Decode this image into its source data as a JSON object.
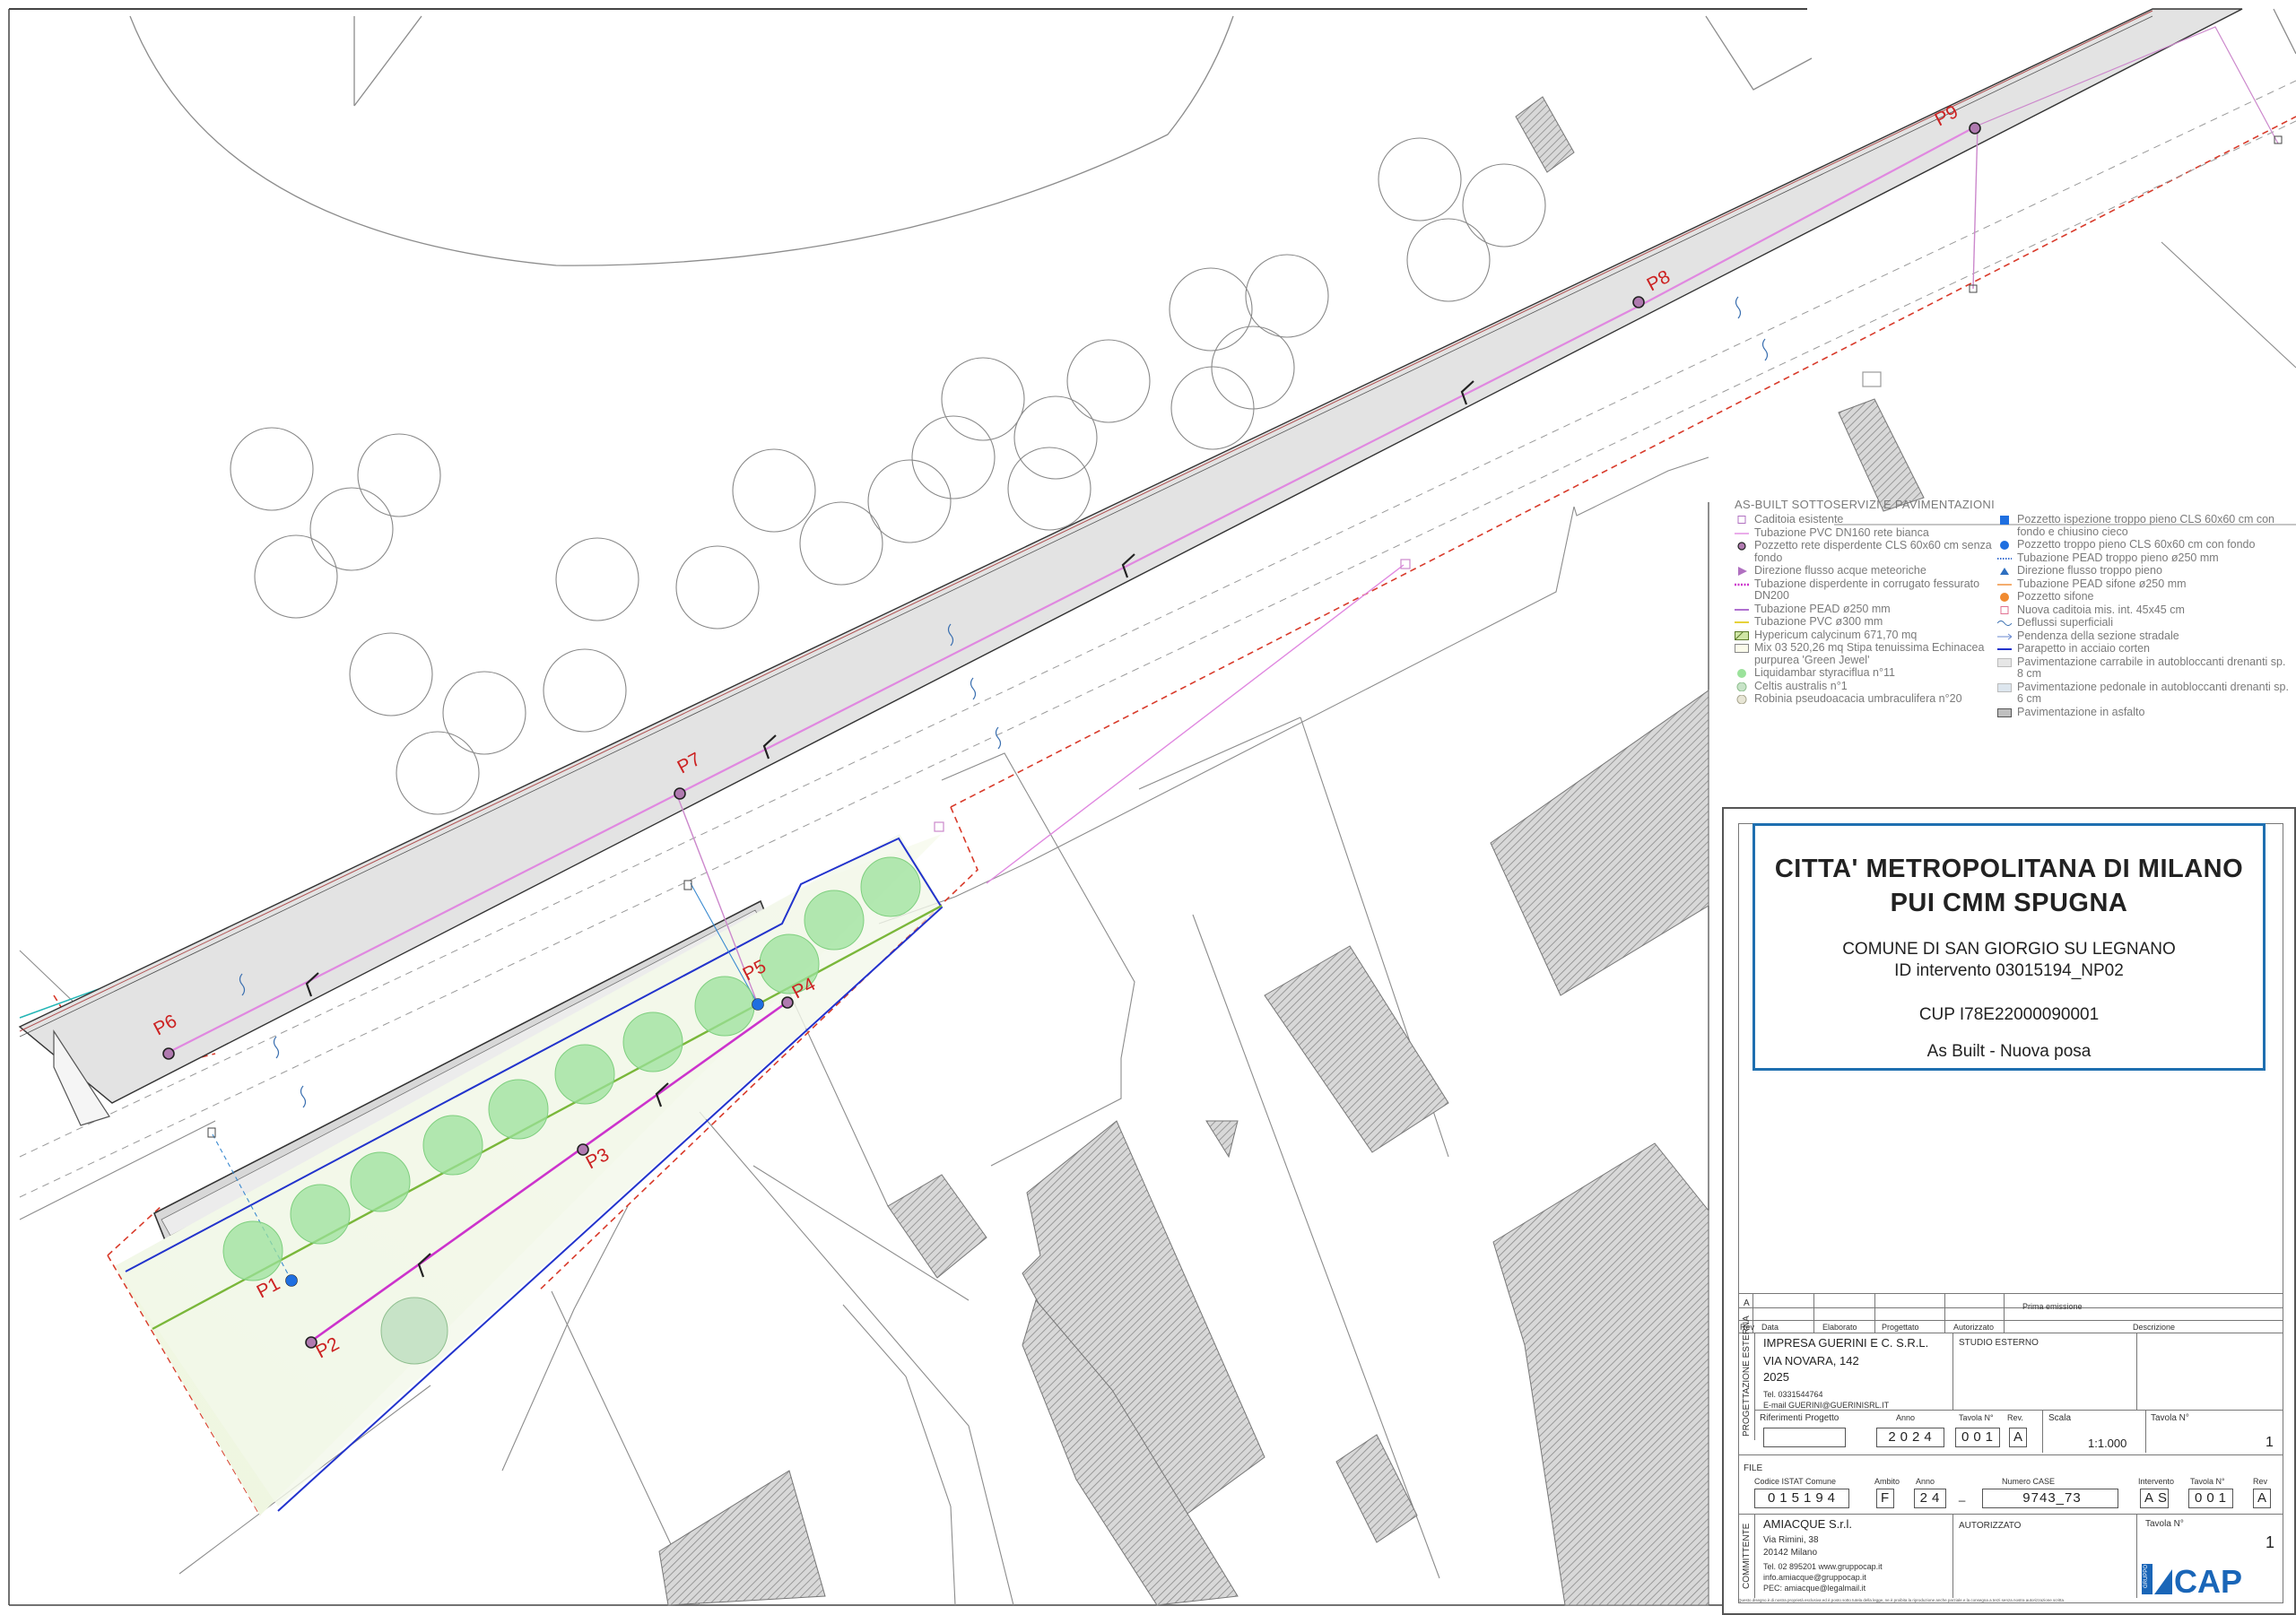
{
  "map": {
    "pozzetti": [
      {
        "label": "P1"
      },
      {
        "label": "P2"
      },
      {
        "label": "P3"
      },
      {
        "label": "P4"
      },
      {
        "label": "P5"
      },
      {
        "label": "P6"
      },
      {
        "label": "P7"
      },
      {
        "label": "P8"
      },
      {
        "label": "P9"
      }
    ],
    "colors": {
      "road_fill": "#e3e3e3",
      "pipe_magenta": "#cc33cc",
      "pipe_pink": "#e088e0",
      "boundary_red": "#d83a2a",
      "parapet_blue": "#2233cc",
      "green_strip": "#7ab73a",
      "tree_green": "#9be29b",
      "cyan_line": "#22b5b5",
      "hatch_grey": "#8a8a8a",
      "label_red": "#cc2222"
    }
  },
  "legend": {
    "title": "AS-BUILT SOTTOSERVIZI E PAVIMENTAZIONI",
    "left": [
      {
        "label": "Caditoia esistente",
        "icon": "square-outline-purple"
      },
      {
        "label": "Tubazione PVC DN160 rete bianca",
        "icon": "line-pink"
      },
      {
        "label": "Pozzetto rete disperdente CLS 60x60 cm senza fondo",
        "icon": "circle-purple"
      },
      {
        "label": "Direzione flusso acque meteoriche",
        "icon": "triangle-purple"
      },
      {
        "label": "Tubazione disperdente in corrugato fessurato DN200",
        "icon": "dashed-magenta"
      },
      {
        "label": "Tubazione PEAD ø250 mm",
        "icon": "line-violet"
      },
      {
        "label": "Tubazione PVC ø300 mm",
        "icon": "line-yellow"
      },
      {
        "label": "Hypericum calycinum 671,70 mq",
        "icon": "hatch-green"
      },
      {
        "label": "Mix 03 520,26 mq Stipa tenuissima Echinacea purpurea 'Green Jewel'",
        "icon": "box-cream"
      },
      {
        "label": "Liquidambar styraciflua n°11",
        "icon": "circle-green"
      },
      {
        "label": "Celtis australis n°1",
        "icon": "circle-lightgreen"
      },
      {
        "label": "Robinia pseudoacacia umbraculifera n°20",
        "icon": "circle-beige"
      }
    ],
    "right": [
      {
        "label": "Pozzetto ispezione troppo pieno CLS 60x60 cm con fondo e chiusino cieco",
        "icon": "square-blue"
      },
      {
        "label": "Pozzetto troppo pieno CLS 60x60 cm con fondo",
        "icon": "circle-blue"
      },
      {
        "label": "Tubazione PEAD troppo pieno ø250 mm",
        "icon": "dotted-blue"
      },
      {
        "label": "Direzione flusso troppo pieno",
        "icon": "triangle-blue"
      },
      {
        "label": "Tubazione PEAD sifone ø250 mm",
        "icon": "line-orange"
      },
      {
        "label": "Pozzetto sifone",
        "icon": "circle-orange"
      },
      {
        "label": "Nuova caditoia mis. int. 45x45 cm",
        "icon": "square-outline-pink"
      },
      {
        "label": "Deflussi superficiali",
        "icon": "squiggle-blue"
      },
      {
        "label": "Pendenza della sezione stradale",
        "icon": "arrow-blue"
      },
      {
        "label": "Parapetto in acciaio corten",
        "icon": "line-navy"
      },
      {
        "label": "Pavimentazione carrabile in autobloccanti drenanti sp. 8 cm",
        "icon": "box-grey"
      },
      {
        "label": "Pavimentazione pedonale in autobloccanti drenanti sp. 6 cm",
        "icon": "box-lightblue"
      },
      {
        "label": "Pavimentazione in asfalto",
        "icon": "box-darkgrey"
      }
    ]
  },
  "titleblock": {
    "title1": "CITTA' METROPOLITANA DI MILANO",
    "title2": "PUI CMM SPUGNA",
    "comune": "COMUNE DI SAN GIORGIO SU LEGNANO",
    "id_intervento": "ID intervento 03015194_NP02",
    "cup": "CUP I78E22000090001",
    "phase": "As Built - Nuova posa",
    "rev_row": {
      "rev": "A",
      "descr": "Prima emissione"
    },
    "rev_headers": {
      "rev": "Rev",
      "data": "Data",
      "elaborato": "Elaborato",
      "progettato": "Progettato",
      "autorizzato": "Autorizzato",
      "descrizione": "Descrizione"
    },
    "progettazione_label": "PROGETTAZIONE ESTERNA",
    "impresa": {
      "name": "IMPRESA GUERINI E C. S.R.L.",
      "addr": "VIA NOVARA, 142",
      "year": "2025",
      "tel": "Tel. 0331544764",
      "email": "E-mail GUERINI@GUERINISRL.IT"
    },
    "studio": "STUDIO ESTERNO",
    "rif": {
      "label": "Riferimenti Progetto",
      "anno_label": "Anno",
      "anno": "2024",
      "tavola_label": "Tavola N°",
      "tavola": "001",
      "rev_label": "Rev.",
      "rev": "A",
      "scala_label": "Scala",
      "scala": "1:1.000",
      "tav_label": "Tavola N°",
      "tav": "1"
    },
    "file": {
      "label": "FILE",
      "istat_label": "Codice ISTAT Comune",
      "istat": "015194",
      "ambito_label": "Ambito",
      "ambito": "F",
      "anno_label": "Anno",
      "anno": "24",
      "sep": "_",
      "case_label": "Numero CASE",
      "case": "9743_73",
      "interv_label": "Intervento",
      "interv": "AS",
      "tavola_label": "Tavola N°",
      "tavola": "001",
      "rev_label": "Rev",
      "rev": "A"
    },
    "committente_label": "COMMITTENTE",
    "amiacque": {
      "name": "AMIACQUE S.r.l.",
      "addr": "Via Rimini, 38",
      "city": "20142 Milano",
      "tel": "Tel. 02 895201 www.gruppocap.it",
      "info": "info.amiacque@gruppocap.it",
      "pec": "PEC: amiacque@legalmail.it"
    },
    "autorizzato": "AUTORIZZATO",
    "tav2_label": "Tavola N°",
    "tav2": "1",
    "logo_text": "CAP",
    "logo_side": "GRUPPO",
    "footer": "Questo disegno è di nostra proprietà esclusiva ed è posto sotto tutela della legge, ne è proibita la riproduzione anche parziale e la consegna a terzi senza nostra autorizzazione scritta."
  }
}
